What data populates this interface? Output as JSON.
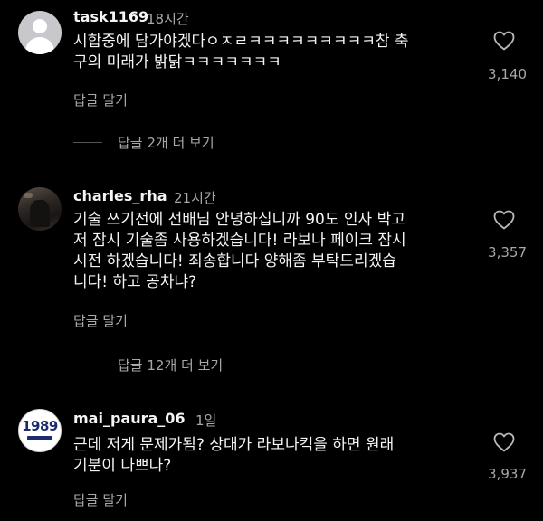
{
  "comments": [
    {
      "username": "task1169",
      "time": "18시간",
      "lines": [
        "시합중에 담가야겠다ㅇㅈㄹㅋㅋㅋㅋㅋㅋㅋㅋㅋ참 축",
        "구의 미래가 밝닭ㅋㅋㅋㅋㅋㅋㅋ"
      ],
      "likes": "3,140",
      "reply_label": "답글 달기",
      "more_replies": "답글 2개 더 보기",
      "avatar": "default-user-icon"
    },
    {
      "username": "charles_rha",
      "time": "21시간",
      "lines": [
        "기술 쓰기전에 선배님 안녕하십니까 90도 인사 박고",
        "저 잠시 기술좀 사용하겠습니다! 라보나 페이크 잠시",
        "시전 하겠습니다! 죄송합니다 양해좀 부탁드리겠습",
        "니다! 하고 공차냐?"
      ],
      "likes": "3,357",
      "reply_label": "답글 달기",
      "more_replies": "답글 12개 더 보기",
      "avatar": "photo"
    },
    {
      "username": "mai_paura_06",
      "time": "1일",
      "lines": [
        "근데 저게 문제가됨? 상대가 라보나킥을 하면 원래",
        "기분이 나쁘나?"
      ],
      "likes": "3,937",
      "reply_label": "답글 달기",
      "avatar": "logo",
      "avatar_logo_text": "1989"
    }
  ],
  "icons": {
    "like": "heart-outline-icon"
  },
  "colors": {
    "background": "#000000",
    "primary_text": "#f5f5f5",
    "secondary_text": "#a8a8a8"
  }
}
